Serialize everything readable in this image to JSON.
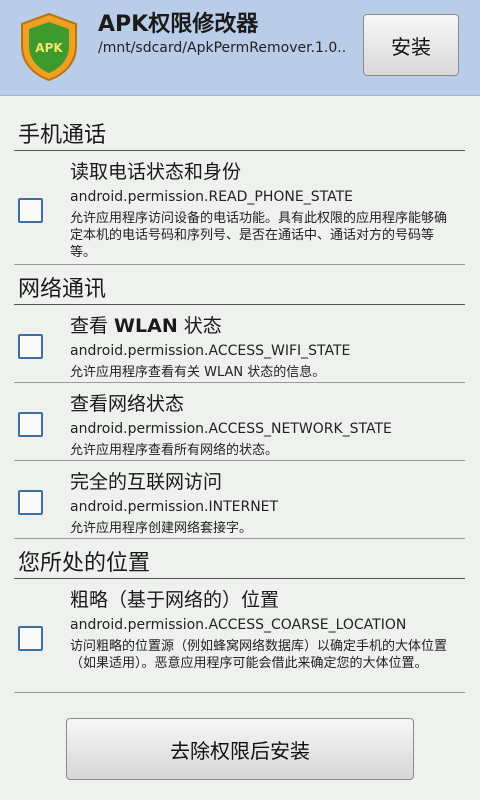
{
  "header": {
    "title": "APK权限修改器",
    "path": "/mnt/sdcard/ApkPermRemover.1.0..",
    "install_label": "安装",
    "logo_text": "APK"
  },
  "sections": [
    {
      "title": "手机通话",
      "items": [
        {
          "title": "读取电话状态和身份",
          "permission": "android.permission.READ_PHONE_STATE",
          "description": "允许应用程序访问设备的电话功能。具有此权限的应用程序能够确定本机的电话号码和序列号、是否在通话中、通话对方的号码等等。",
          "checked": false
        }
      ]
    },
    {
      "title": "网络通讯",
      "items": [
        {
          "title_prefix": "查看 ",
          "title_bold": "WLAN",
          "title_suffix": " 状态",
          "permission": "android.permission.ACCESS_WIFI_STATE",
          "description": "允许应用程序查看有关 WLAN 状态的信息。",
          "checked": false
        },
        {
          "title": "查看网络状态",
          "permission": "android.permission.ACCESS_NETWORK_STATE",
          "description": "允许应用程序查看所有网络的状态。",
          "checked": false
        },
        {
          "title": "完全的互联网访问",
          "permission": "android.permission.INTERNET",
          "description": "允许应用程序创建网络套接字。",
          "checked": false
        }
      ]
    },
    {
      "title": "您所处的位置",
      "items": [
        {
          "title": "粗略（基于网络的）位置",
          "permission": "android.permission.ACCESS_COARSE_LOCATION",
          "description": "访问粗略的位置源（例如蜂窝网络数据库）以确定手机的大体位置（如果适用）。恶意应用程序可能会借此来确定您的大体位置。",
          "checked": false
        }
      ]
    }
  ],
  "footer": {
    "button_label": "去除权限后安装"
  },
  "colors": {
    "header_bg": "#b9cde9",
    "checkbox_border": "#3b6fa6",
    "shield_orange": "#f0a020",
    "shield_green": "#3f9a2e"
  }
}
